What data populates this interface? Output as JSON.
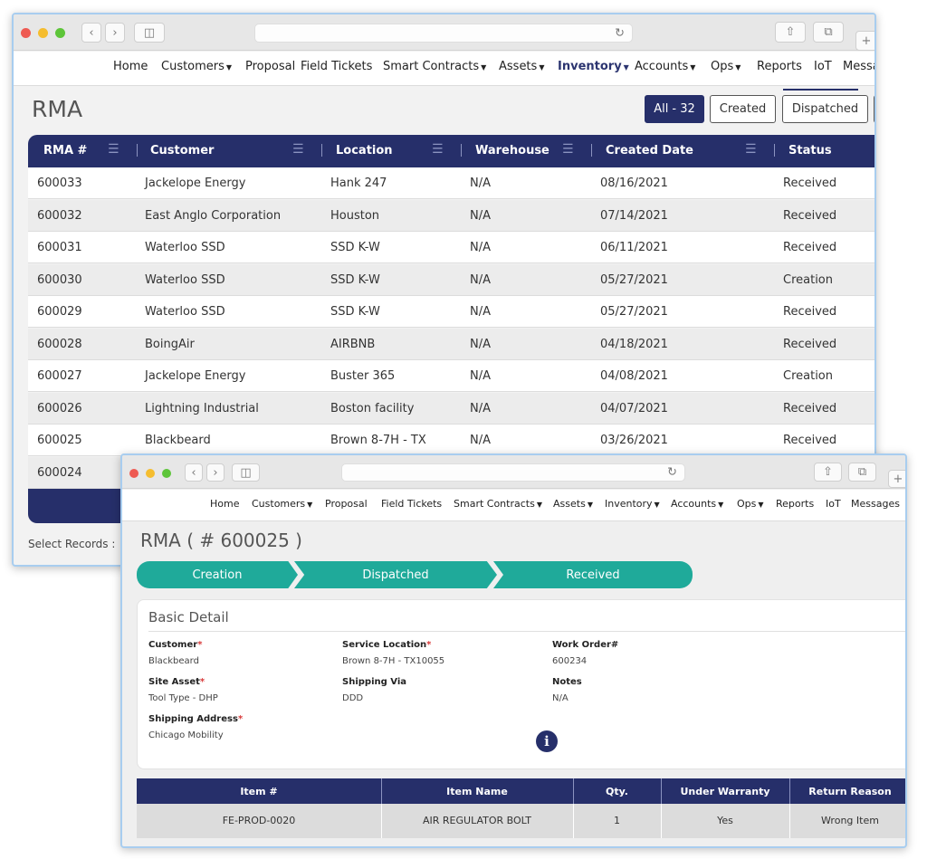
{
  "back_window": {
    "nav": {
      "items": [
        {
          "label": "Home",
          "caret": false
        },
        {
          "label": "Customers",
          "caret": true
        },
        {
          "label": "Proposal",
          "caret": false
        },
        {
          "label": "Field Tickets",
          "caret": false
        },
        {
          "label": "Smart Contracts",
          "caret": true
        },
        {
          "label": "Assets",
          "caret": true
        },
        {
          "label": "Inventory",
          "caret": true,
          "active": true
        },
        {
          "label": "Accounts",
          "caret": true
        },
        {
          "label": "Ops",
          "caret": true
        },
        {
          "label": "Reports",
          "caret": false
        },
        {
          "label": "IoT",
          "caret": false
        },
        {
          "label": "Messa",
          "caret": false
        }
      ]
    },
    "page_title": "RMA",
    "filters": [
      {
        "label": "All - 32",
        "active": true
      },
      {
        "label": "Created",
        "active": false
      },
      {
        "label": "Dispatched",
        "active": false
      }
    ],
    "table": {
      "columns": [
        "RMA #",
        "Customer",
        "Location",
        "Warehouse",
        "Created Date",
        "Status"
      ],
      "rows": [
        [
          "600033",
          "Jackelope Energy",
          "Hank 247",
          "N/A",
          "08/16/2021",
          "Received"
        ],
        [
          "600032",
          "East Anglo Corporation",
          "Houston",
          "N/A",
          "07/14/2021",
          "Received"
        ],
        [
          "600031",
          "Waterloo SSD",
          "SSD K-W",
          "N/A",
          "06/11/2021",
          "Received"
        ],
        [
          "600030",
          "Waterloo SSD",
          "SSD K-W",
          "N/A",
          "05/27/2021",
          "Creation"
        ],
        [
          "600029",
          "Waterloo SSD",
          "SSD K-W",
          "N/A",
          "05/27/2021",
          "Received"
        ],
        [
          "600028",
          "BoingAir",
          "AIRBNB",
          "N/A",
          "04/18/2021",
          "Received"
        ],
        [
          "600027",
          "Jackelope Energy",
          "Buster 365",
          "N/A",
          "04/08/2021",
          "Creation"
        ],
        [
          "600026",
          "Lightning Industrial",
          "Boston facility",
          "N/A",
          "04/07/2021",
          "Received"
        ],
        [
          "600025",
          "Blackbeard",
          "Brown 8-7H - TX",
          "N/A",
          "03/26/2021",
          "Received"
        ],
        [
          "600024",
          "",
          "",
          "",
          "",
          ""
        ]
      ]
    },
    "select_records_label": "Select Records :"
  },
  "front_window": {
    "nav": {
      "items": [
        {
          "label": "Home",
          "caret": false
        },
        {
          "label": "Customers",
          "caret": true
        },
        {
          "label": "Proposal",
          "caret": false
        },
        {
          "label": "Field Tickets",
          "caret": false
        },
        {
          "label": "Smart Contracts",
          "caret": true
        },
        {
          "label": "Assets",
          "caret": true
        },
        {
          "label": "Inventory",
          "caret": true
        },
        {
          "label": "Accounts",
          "caret": true
        },
        {
          "label": "Ops",
          "caret": true
        },
        {
          "label": "Reports",
          "caret": false
        },
        {
          "label": "IoT",
          "caret": false
        },
        {
          "label": "Messages",
          "caret": false
        }
      ]
    },
    "page_title": "RMA ( # 600025 )",
    "steps": [
      "Creation",
      "Dispatched",
      "Received"
    ],
    "basic_detail": {
      "title": "Basic Detail",
      "fields": [
        {
          "label": "Customer",
          "required": true,
          "value": "Blackbeard"
        },
        {
          "label": "Service Location",
          "required": true,
          "value": "Brown 8-7H - TX10055"
        },
        {
          "label": "Work Order#",
          "required": false,
          "value": "600234"
        },
        {
          "label": "Site Asset",
          "required": true,
          "value": "Tool Type - DHP"
        },
        {
          "label": "Shipping Via",
          "required": false,
          "value": "DDD"
        },
        {
          "label": "Notes",
          "required": false,
          "value": "N/A"
        },
        {
          "label": "Shipping Address",
          "required": true,
          "value": "Chicago Mobility"
        }
      ],
      "info_icon": "i"
    },
    "items_table": {
      "columns": [
        "Item #",
        "Item Name",
        "Qty.",
        "Under Warranty",
        "Return Reason"
      ],
      "rows": [
        [
          "FE-PROD-0020",
          "AIR REGULATOR BOLT",
          "1",
          "Yes",
          "Wrong Item"
        ]
      ]
    }
  },
  "colors": {
    "navy": "#262f6a",
    "teal": "#1faa9a",
    "required": "#d83a3a",
    "window_border": "#a8cdef"
  },
  "icons": [
    "back-icon",
    "forward-icon",
    "sidebar-icon",
    "reload-icon",
    "share-icon",
    "tabs-icon",
    "new-tab-icon",
    "column-menu-icon",
    "info-icon"
  ]
}
